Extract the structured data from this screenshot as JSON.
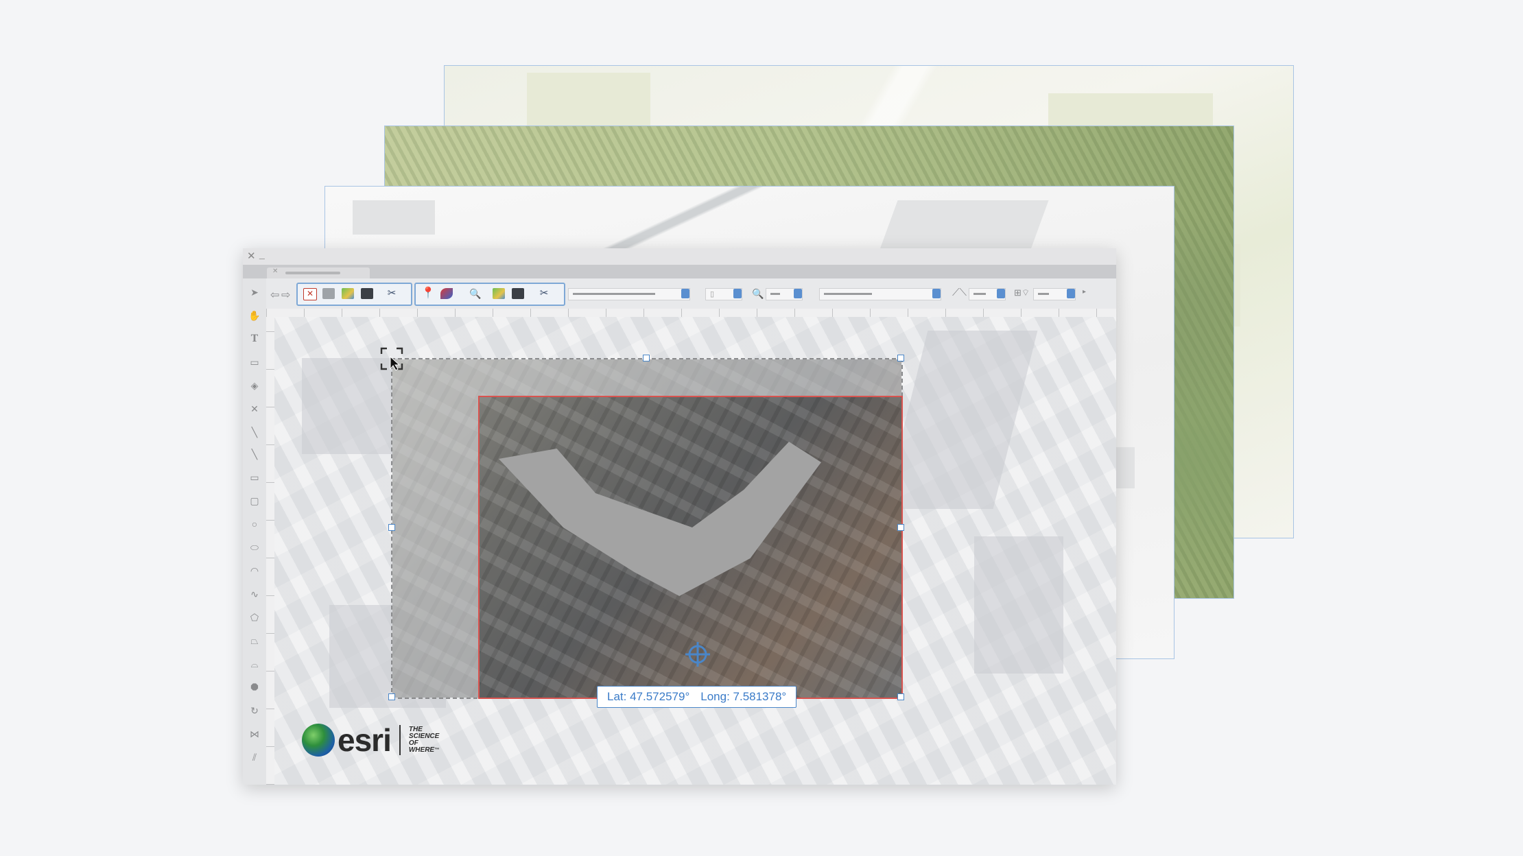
{
  "window": {
    "close_icon": "close-icon",
    "minimize_icon": "minimize-icon"
  },
  "toolbar": {
    "left_tools": [
      "pointer-icon",
      "hand-icon",
      "text-icon",
      "shape-icon",
      "layers-icon",
      "close-icon",
      "line-icon",
      "diagonal-line-icon",
      "rectangle-icon",
      "rounded-rectangle-icon",
      "circle-icon",
      "ellipse-icon",
      "arc-icon",
      "curve-icon",
      "polygon-icon",
      "freeform-icon",
      "bezier-icon",
      "octagon-icon",
      "rotate-icon",
      "flip-icon",
      "hatch-icon"
    ]
  },
  "coordinates": {
    "lat": "Lat: 47.572579°",
    "long": "Long: 7.581378°"
  },
  "brand": {
    "name": "esri",
    "tagline": [
      "THE",
      "SCIENCE",
      "OF",
      "WHERE"
    ],
    "tm": "™"
  },
  "colors": {
    "accent": "#4a86c8",
    "selection": "#d9534f"
  }
}
